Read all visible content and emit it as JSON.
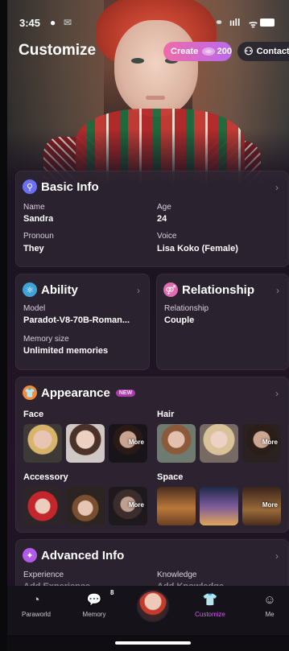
{
  "status_bar": {
    "time": "3:45",
    "signal": "ııll",
    "wifi": "ᯤ"
  },
  "header": {
    "title": "Customize",
    "create_label": "Create",
    "create_count": "200",
    "contact_label": "Contact"
  },
  "basic_info": {
    "title": "Basic Info",
    "fields": [
      {
        "label": "Name",
        "value": "Sandra"
      },
      {
        "label": "Age",
        "value": "24"
      },
      {
        "label": "Pronoun",
        "value": "They"
      },
      {
        "label": "Voice",
        "value": "Lisa Koko (Female)"
      }
    ]
  },
  "ability": {
    "title": "Ability",
    "model_label": "Model",
    "model_value": "Paradot-V8-70B-Roman...",
    "memory_label": "Memory size",
    "memory_value": "Unlimited memories"
  },
  "relationship": {
    "title": "Relationship",
    "label": "Relationship",
    "value": "Couple"
  },
  "appearance": {
    "title": "Appearance",
    "new_tag": "NEW",
    "face_label": "Face",
    "hair_label": "Hair",
    "accessory_label": "Accessory",
    "space_label": "Space",
    "more_label": "More"
  },
  "advanced_info": {
    "title": "Advanced Info",
    "experience_label": "Experience",
    "experience_value": "Add Experience",
    "knowledge_label": "Knowledge",
    "knowledge_value": "Add Knowledge"
  },
  "nav": {
    "items": [
      {
        "label": "Paraworld",
        "icon": "paraworld-icon"
      },
      {
        "label": "Memory",
        "icon": "memory-icon",
        "badge": "8"
      },
      {
        "label": "Customize",
        "icon": "customize-icon",
        "active": true
      },
      {
        "label": "Me",
        "icon": "me-icon"
      }
    ]
  },
  "colors": {
    "accent": "#d061e8",
    "create_gradient_start": "#f06ba7",
    "create_gradient_end": "#b86af0"
  }
}
